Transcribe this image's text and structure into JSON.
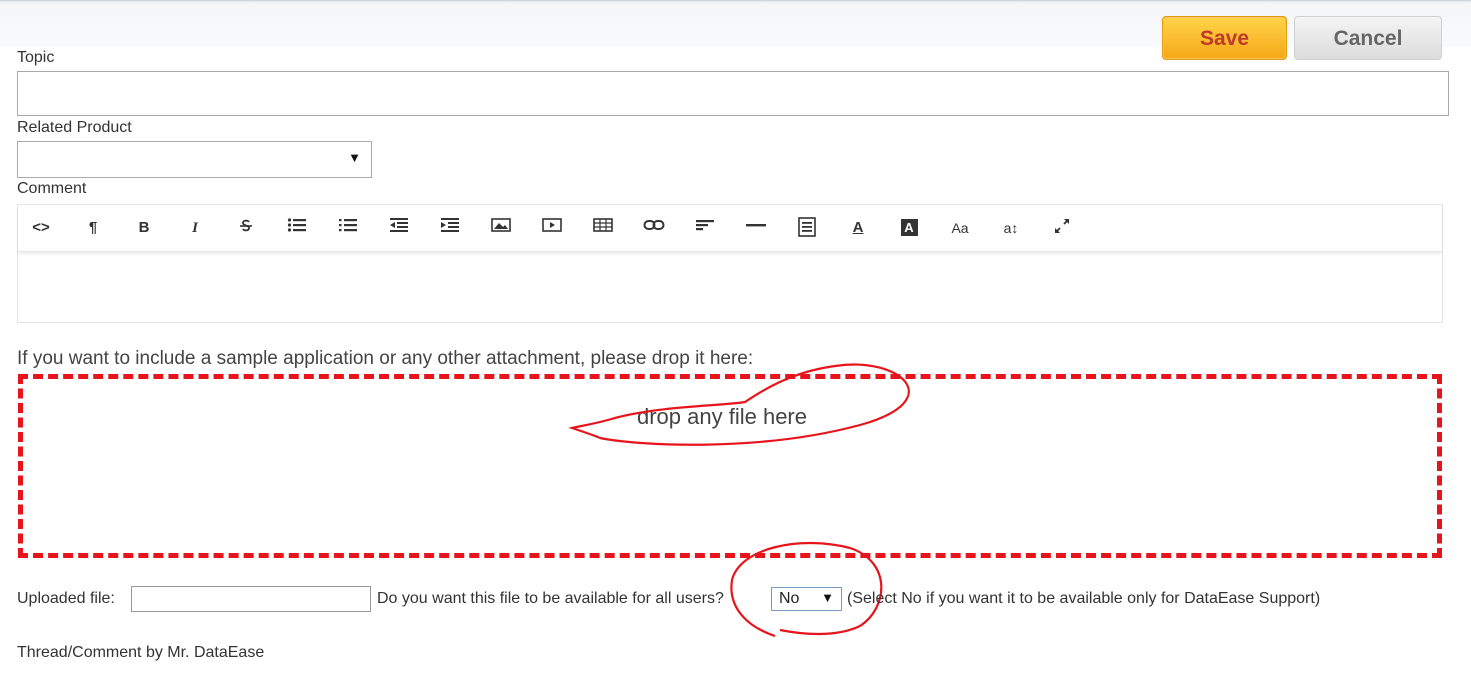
{
  "buttons": {
    "save_label": "Save",
    "cancel_label": "Cancel"
  },
  "form": {
    "topic_label": "Topic",
    "topic_value": "",
    "related_product_label": "Related Product",
    "related_product_value": "",
    "comment_label": "Comment",
    "comment_value": ""
  },
  "toolbar": {
    "items": [
      "code-view-icon",
      "paragraph-icon",
      "bold-icon",
      "italic-icon",
      "strikethrough-icon",
      "bullet-list-icon",
      "numbered-list-icon",
      "outdent-icon",
      "indent-icon",
      "image-icon",
      "video-icon",
      "table-icon",
      "link-icon",
      "align-icon",
      "horizontal-rule-icon",
      "format-block-icon",
      "text-color-icon",
      "background-color-icon",
      "font-size-icon",
      "line-height-icon",
      "fullscreen-icon"
    ],
    "bold_glyph": "B",
    "italic_glyph": "I",
    "paragraph_glyph": "¶",
    "code_glyph": "<>",
    "text_color_glyph": "A",
    "bg_color_glyph": "A",
    "font_size_glyph": "Aa",
    "line_height_glyph": "a↕"
  },
  "attachment": {
    "intro": "If you want to include a sample application or any other attachment, please drop it here:",
    "drop_text": "drop any file here",
    "border_color": "#e8141c"
  },
  "upload": {
    "label": "Uploaded file:",
    "file_value": "",
    "question": "Do you want this file to be available for all users?",
    "selected": "No",
    "note": "(Select No if you want it to be available only for DataEase Support)"
  },
  "thread": {
    "text": "Thread/Comment by Mr. DataEase"
  }
}
